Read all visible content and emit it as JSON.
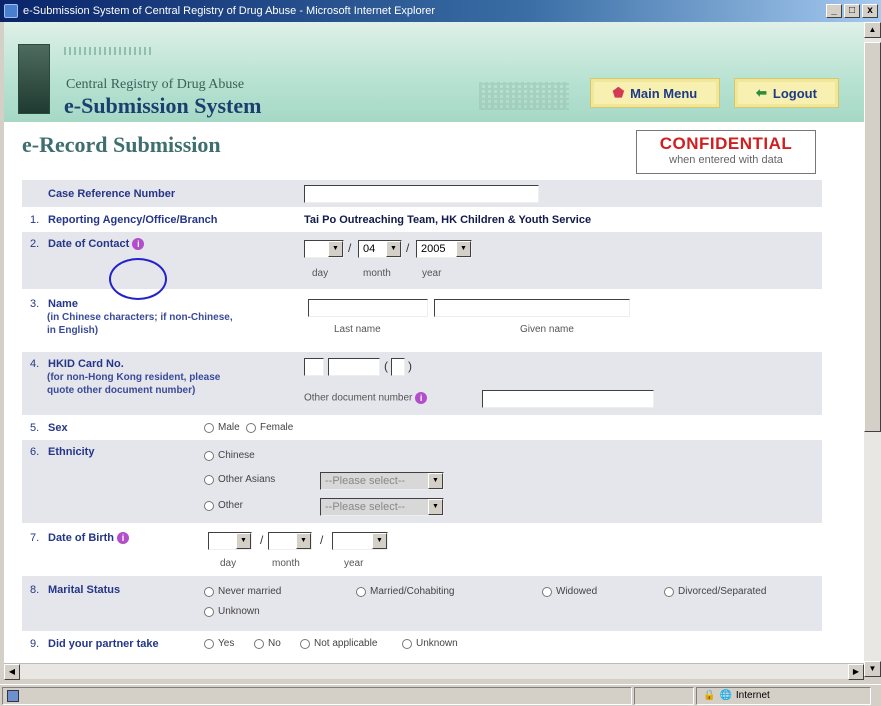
{
  "window": {
    "title": "e-Submission System of Central Registry of Drug Abuse - Microsoft Internet Explorer"
  },
  "banner": {
    "subtitle": "Central Registry of Drug Abuse",
    "system": "e-Submission System",
    "main_menu": "Main Menu",
    "logout": "Logout"
  },
  "page": {
    "heading": "e-Record Submission",
    "confidential": "CONFIDENTIAL",
    "confidential_note": "when entered with data"
  },
  "form": {
    "case_ref": {
      "label": "Case Reference Number",
      "value": ""
    },
    "agency": {
      "num": "1.",
      "label": "Reporting Agency/Office/Branch",
      "value": "Tai Po Outreaching Team, HK Children & Youth Service"
    },
    "contact": {
      "num": "2.",
      "label": "Date of Contact",
      "day": "",
      "month": "04",
      "year": "2005",
      "cap_day": "day",
      "cap_month": "month",
      "cap_year": "year"
    },
    "name": {
      "num": "3.",
      "label": "Name",
      "note1": "(in Chinese characters; if non-Chinese,",
      "note2": "in English)",
      "last_cap": "Last name",
      "given_cap": "Given name"
    },
    "hkid": {
      "num": "4.",
      "label": "HKID Card No.",
      "note1": "(for non-Hong Kong resident, please",
      "note2": "quote other document number)",
      "other_cap": "Other document number",
      "open": "(",
      "close": ")"
    },
    "sex": {
      "num": "5.",
      "label": "Sex",
      "male": "Male",
      "female": "Female"
    },
    "ethnicity": {
      "num": "6.",
      "label": "Ethnicity",
      "chinese": "Chinese",
      "other_asians": "Other Asians",
      "other": "Other",
      "select_ph": "--Please select--"
    },
    "dob": {
      "num": "7.",
      "label": "Date of Birth",
      "cap_day": "day",
      "cap_month": "month",
      "cap_year": "year"
    },
    "marital": {
      "num": "8.",
      "label": "Marital Status",
      "o1": "Never married",
      "o2": "Married/Cohabiting",
      "o3": "Widowed",
      "o4": "Divorced/Separated",
      "o5": "Unknown"
    },
    "partner": {
      "num": "9.",
      "label": "Did your partner take",
      "o1": "Yes",
      "o2": "No",
      "o3": "Not applicable",
      "o4": "Unknown"
    }
  },
  "status": {
    "zone": "Internet"
  },
  "colors": {
    "accent": "#3f6e6f",
    "confidential": "#d11f1f",
    "row_shade": "#e5e5ec",
    "annotation": "#2222cc"
  }
}
